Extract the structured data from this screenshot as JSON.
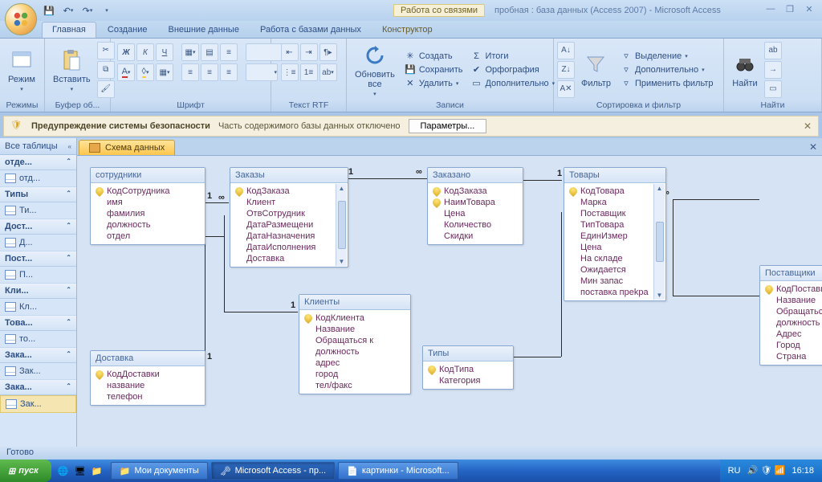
{
  "titlebar": {
    "context_label": "Работа со связями",
    "app_title": "пробная : база данных (Access 2007) - Microsoft Access"
  },
  "tabs": {
    "home": "Главная",
    "create": "Создание",
    "external": "Внешние данные",
    "dbwork": "Работа с базами данных",
    "designer": "Конструктор"
  },
  "ribbon": {
    "group_views": "Режимы",
    "view": "Режим",
    "group_clipboard": "Буфер об...",
    "paste": "Вставить",
    "group_font": "Шрифт",
    "group_rtf": "Текст RTF",
    "group_records": "Записи",
    "refresh": "Обновить\nвсе",
    "new": "Создать",
    "save": "Сохранить",
    "delete": "Удалить",
    "totals": "Итоги",
    "spelling": "Орфография",
    "more": "Дополнительно",
    "group_sortfilter": "Сортировка и фильтр",
    "filter": "Фильтр",
    "selection": "Выделение",
    "advanced": "Дополнительно",
    "apply_filter": "Применить фильтр",
    "group_find": "Найти",
    "find": "Найти"
  },
  "security": {
    "title": "Предупреждение системы безопасности",
    "msg": "Часть содержимого базы данных отключено",
    "button": "Параметры..."
  },
  "nav": {
    "header": "Все таблицы",
    "groups": [
      {
        "head": "отде...",
        "items": [
          "отд..."
        ]
      },
      {
        "head": "Типы",
        "items": [
          "Ти..."
        ]
      },
      {
        "head": "Дост...",
        "items": [
          "Д..."
        ]
      },
      {
        "head": "Пост...",
        "items": [
          "П..."
        ]
      },
      {
        "head": "Кли...",
        "items": [
          "Кл..."
        ]
      },
      {
        "head": "Това...",
        "items": [
          "то..."
        ]
      },
      {
        "head": "Зака...",
        "items": [
          "Зак..."
        ]
      },
      {
        "head": "Зака...",
        "items": [
          "Зак..."
        ]
      }
    ]
  },
  "doc_tab": "Схема данных",
  "tables": {
    "t1": {
      "title": "сотрудники",
      "fields": [
        "КодСотрудника",
        "имя",
        "фамилия",
        "должность",
        "отдел"
      ],
      "keys": [
        0
      ]
    },
    "t2": {
      "title": "Заказы",
      "fields": [
        "КодЗаказа",
        "Клиент",
        "ОтвСотрудник",
        "ДатаРазмещени",
        "ДатаНазначения",
        "ДатаИсполнения",
        "Доставка"
      ],
      "keys": [
        0
      ]
    },
    "t3": {
      "title": "Заказано",
      "fields": [
        "КодЗаказа",
        "НаимТовара",
        "Цена",
        "Количество",
        "Скидки"
      ],
      "keys": [
        0,
        1
      ]
    },
    "t4": {
      "title": "Товары",
      "fields": [
        "КодТовара",
        "Марка",
        "Поставщик",
        "ТипТовара",
        "ЕдинИзмер",
        "Цена",
        "На складе",
        "Ожидается",
        "Мин запас",
        "поставка преkра"
      ],
      "keys": [
        0
      ]
    },
    "t5": {
      "title": "Поставщики",
      "fields": [
        "КодПоставщика",
        "Название",
        "Обращаться к",
        "должность",
        "Адрес",
        "Город",
        "Страна"
      ],
      "keys": [
        0
      ]
    },
    "t6": {
      "title": "Доставка",
      "fields": [
        "КодДоставки",
        "название",
        "телефон"
      ],
      "keys": [
        0
      ]
    },
    "t7": {
      "title": "Клиенты",
      "fields": [
        "КодКлиента",
        "Название",
        "Обращаться к",
        "должность",
        "адрес",
        "город",
        "тел/факс"
      ],
      "keys": [
        0
      ]
    },
    "t8": {
      "title": "Типы",
      "fields": [
        "КодТипа",
        "Категория"
      ],
      "keys": [
        0
      ]
    }
  },
  "status": "Готово",
  "taskbar": {
    "start": "пуск",
    "task1": "Мои документы",
    "task2": "Microsoft Access - пр...",
    "task3": "картинки - Microsoft...",
    "lang": "RU",
    "clock": "16:18"
  }
}
